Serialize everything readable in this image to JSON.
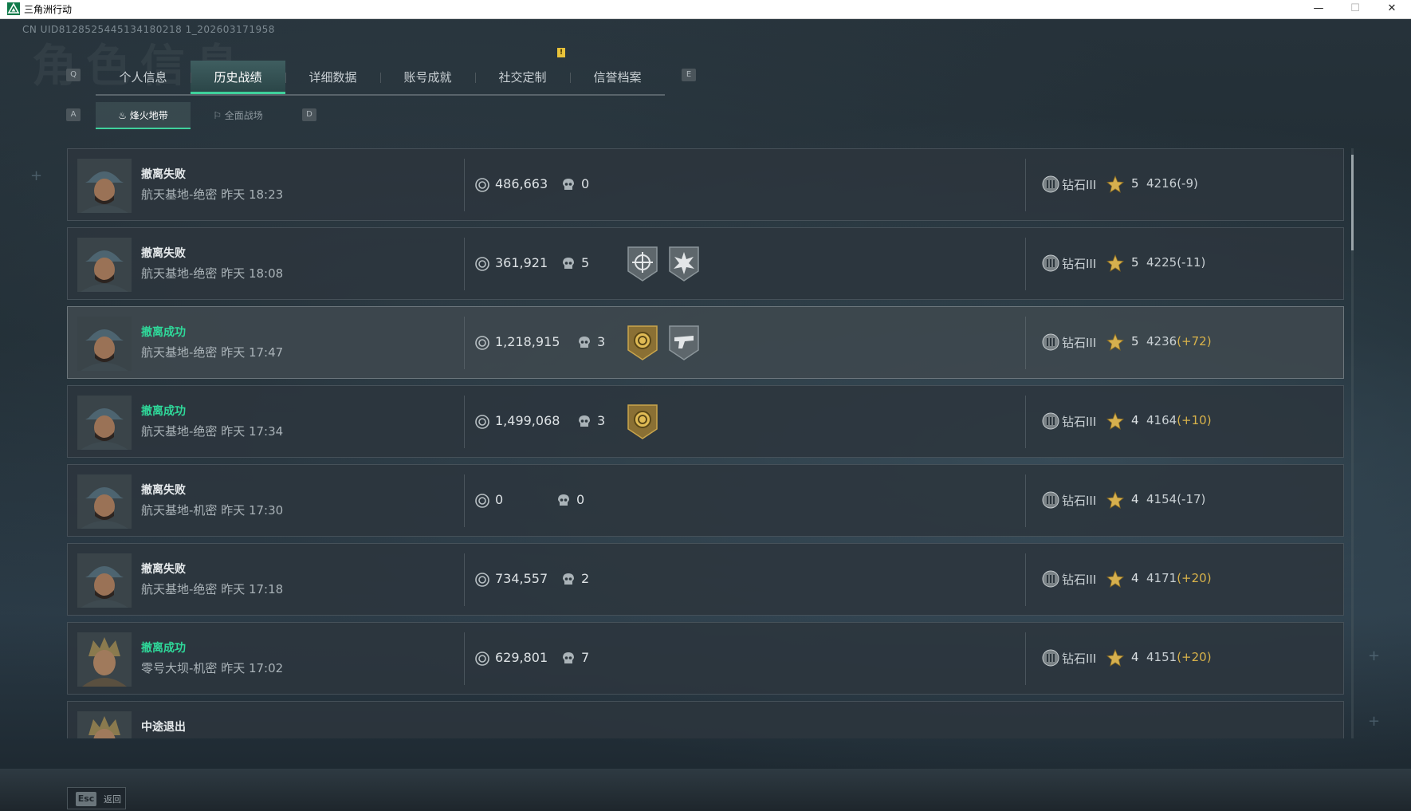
{
  "window": {
    "title": "三角洲行动",
    "minimize": "—",
    "maximize": "☐",
    "close": "✕"
  },
  "uid_text": "CN UID8128525445134180218 1_202603171958",
  "bg_title": "角色信息",
  "main_tabs": {
    "prev_key": "Q",
    "next_key": "E",
    "items": [
      {
        "label": "个人信息",
        "active": false
      },
      {
        "label": "历史战绩",
        "active": true
      },
      {
        "label": "详细数据",
        "active": false
      },
      {
        "label": "账号成就",
        "active": false
      },
      {
        "label": "社交定制",
        "active": false,
        "notice": "!"
      },
      {
        "label": "信誉档案",
        "active": false
      }
    ]
  },
  "sub_tabs": {
    "prev_key": "A",
    "next_key": "D",
    "items": [
      {
        "label": "烽火地带",
        "icon": "flame-zone-icon",
        "active": true
      },
      {
        "label": "全面战场",
        "icon": "battlefield-icon",
        "active": false
      }
    ]
  },
  "records": [
    {
      "status": "撤离失败",
      "success": false,
      "map": "航天基地-绝密",
      "time": "昨天 18:23",
      "value": "486,663",
      "kills": "0",
      "medals": [],
      "rank": "钻石III",
      "stars": "5",
      "score": "4216",
      "delta": "(-9)",
      "delta_positive": false,
      "avatar": "operator-a"
    },
    {
      "status": "撤离失败",
      "success": false,
      "map": "航天基地-绝密",
      "time": "昨天 18:08",
      "value": "361,921",
      "kills": "5",
      "medals": [
        "crosshair-medal",
        "burst-medal"
      ],
      "rank": "钻石III",
      "stars": "5",
      "score": "4225",
      "delta": "(-11)",
      "delta_positive": false,
      "avatar": "operator-a"
    },
    {
      "status": "撤离成功",
      "success": true,
      "map": "航天基地-绝密",
      "time": "昨天 17:47",
      "value": "1,218,915",
      "kills": "3",
      "medals": [
        "gold-coin-medal",
        "gun-medal"
      ],
      "rank": "钻石III",
      "stars": "5",
      "score": "4236",
      "delta": "(+72)",
      "delta_positive": true,
      "avatar": "operator-a",
      "highlight": true
    },
    {
      "status": "撤离成功",
      "success": true,
      "map": "航天基地-绝密",
      "time": "昨天 17:34",
      "value": "1,499,068",
      "kills": "3",
      "medals": [
        "gold-coin-medal"
      ],
      "rank": "钻石III",
      "stars": "4",
      "score": "4164",
      "delta": "(+10)",
      "delta_positive": true,
      "avatar": "operator-a"
    },
    {
      "status": "撤离失败",
      "success": false,
      "map": "航天基地-机密",
      "time": "昨天 17:30",
      "value": "0",
      "kills": "0",
      "medals": [],
      "rank": "钻石III",
      "stars": "4",
      "score": "4154",
      "delta": "(-17)",
      "delta_positive": false,
      "avatar": "operator-a"
    },
    {
      "status": "撤离失败",
      "success": false,
      "map": "航天基地-绝密",
      "time": "昨天 17:18",
      "value": "734,557",
      "kills": "2",
      "medals": [],
      "rank": "钻石III",
      "stars": "4",
      "score": "4171",
      "delta": "(+20)",
      "delta_positive": true,
      "avatar": "operator-a"
    },
    {
      "status": "撤离成功",
      "success": true,
      "map": "零号大坝-机密",
      "time": "昨天 17:02",
      "value": "629,801",
      "kills": "7",
      "medals": [],
      "rank": "钻石III",
      "stars": "4",
      "score": "4151",
      "delta": "(+20)",
      "delta_positive": true,
      "avatar": "operator-b"
    },
    {
      "status": "中途退出",
      "success": false,
      "map": "",
      "time": "",
      "value": "",
      "kills": "",
      "medals": [],
      "rank": "",
      "stars": "",
      "score": "",
      "delta": "",
      "delta_positive": false,
      "avatar": "operator-b",
      "partial": true
    }
  ],
  "bottom": {
    "esc_key": "Esc",
    "back_label": "返回"
  },
  "colors": {
    "accent": "#3fd19c",
    "success": "#2fd99a",
    "positive_delta": "#d8b24a"
  }
}
